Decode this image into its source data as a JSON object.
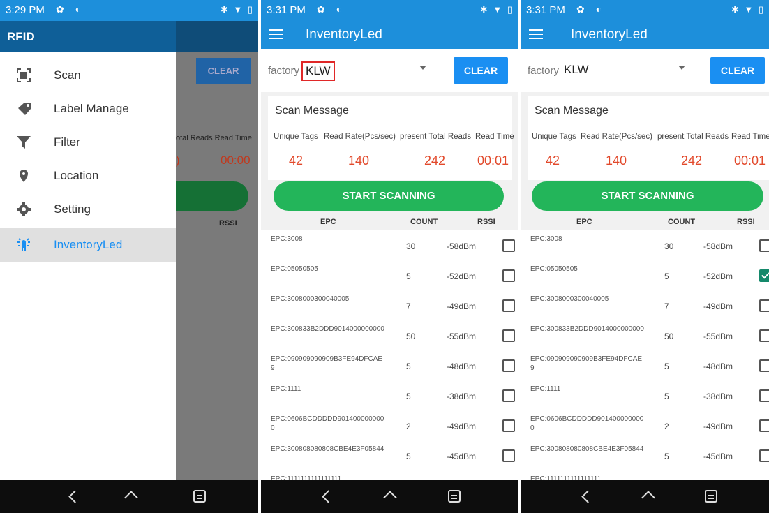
{
  "status": {
    "p1_time": "3:29 PM",
    "p2_time": "3:31 PM",
    "p3_time": "3:31 PM",
    "left_icons": "✿ ◐",
    "right_icons": "✱ ▼ ▯"
  },
  "drawer": {
    "title": "RFID",
    "items": [
      {
        "label": "Scan",
        "icon": "scan-icon"
      },
      {
        "label": "Label Manage",
        "icon": "tag-icon"
      },
      {
        "label": "Filter",
        "icon": "filter-icon"
      },
      {
        "label": "Location",
        "icon": "location-icon"
      },
      {
        "label": "Setting",
        "icon": "gear-icon"
      },
      {
        "label": "InventoryLed",
        "icon": "led-icon"
      }
    ],
    "dimmed_clear": "CLEAR",
    "dimmed_headers": "otal Reads  Read Time",
    "dimmed_total": ")",
    "dimmed_time": "00:00",
    "dimmed_rssi": "RSSI"
  },
  "app": {
    "title": "InventoryLed",
    "factory_label": "factory",
    "factory_value": "KLW",
    "clear_label": "CLEAR",
    "scan_title": "Scan Message",
    "stat_headers": [
      "Unique Tags",
      "Read Rate(Pcs/sec)",
      "present Total Reads",
      "Read Time"
    ],
    "stat_values": [
      "42",
      "140",
      "242",
      "00:01"
    ],
    "start_label": "START SCANNING",
    "col_epc": "EPC",
    "col_count": "COUNT",
    "col_rssi": "RSSI"
  },
  "rows": [
    {
      "epc": "EPC:3008",
      "count": "30",
      "rssi": "-58dBm"
    },
    {
      "epc": "EPC:05050505",
      "count": "5",
      "rssi": "-52dBm"
    },
    {
      "epc": "EPC:3008000300040005",
      "count": "7",
      "rssi": "-49dBm"
    },
    {
      "epc": "EPC:300833B2DDD9014000000000",
      "count": "50",
      "rssi": "-55dBm"
    },
    {
      "epc": "EPC:090909090909B3FE94DFCAE9",
      "count": "5",
      "rssi": "-48dBm"
    },
    {
      "epc": "EPC:1111",
      "count": "5",
      "rssi": "-38dBm"
    },
    {
      "epc": "EPC:0606BCDDDDD9014000000000",
      "count": "2",
      "rssi": "-49dBm"
    },
    {
      "epc": "EPC:300808080808CBE4E3F05844",
      "count": "5",
      "rssi": "-45dBm"
    },
    {
      "epc": "EPC:1111111111111111",
      "count": "",
      "rssi": ""
    }
  ],
  "p3_checked_row": 1,
  "colors": {
    "primary": "#1d8fdb",
    "accent_blue": "#1a8ff2",
    "green": "#23b55a",
    "stat_red": "#e2492b",
    "highlight_red": "#e02828"
  }
}
